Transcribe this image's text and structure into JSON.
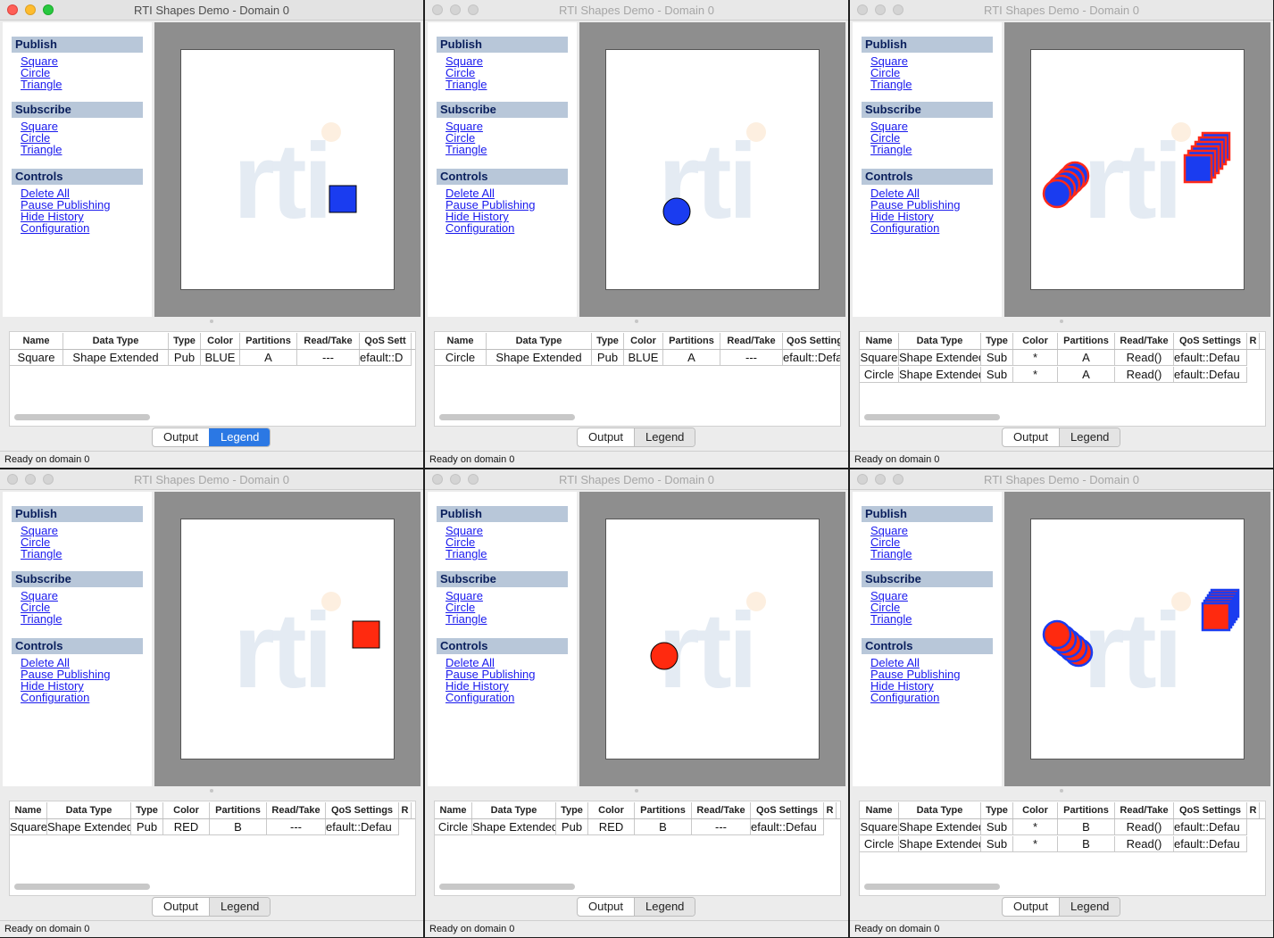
{
  "windows": [
    {
      "title": "RTI Shapes Demo - Domain 0",
      "active": true,
      "shapes": [
        {
          "kind": "square",
          "fill": "#1a3cf0",
          "stroke": "#000000",
          "color": "BLUE"
        }
      ],
      "columns": [
        "Name",
        "Data Type",
        "Type",
        "Color",
        "Partitions",
        "Read/Take",
        "QoS Sett"
      ],
      "rows": [
        [
          "Square",
          "Shape Extended",
          "Pub",
          "BLUE",
          "A",
          "---",
          "efault::D"
        ]
      ],
      "selected_tab": "Legend"
    },
    {
      "title": "RTI Shapes Demo - Domain 0",
      "active": false,
      "shapes": [
        {
          "kind": "circle",
          "fill": "#1a3cf0",
          "stroke": "#000000",
          "color": "BLUE"
        }
      ],
      "columns": [
        "Name",
        "Data Type",
        "Type",
        "Color",
        "Partitions",
        "Read/Take",
        "QoS Setting"
      ],
      "rows": [
        [
          "Circle",
          "Shape Extended",
          "Pub",
          "BLUE",
          "A",
          "---",
          "efault::Defa"
        ]
      ],
      "selected_tab": "Legend"
    },
    {
      "title": "RTI Shapes Demo - Domain 0",
      "active": false,
      "shapes": [
        {
          "kind": "circle-trail",
          "fill": "#1a3cf0",
          "stroke": "#ff2a1a"
        },
        {
          "kind": "square-trail",
          "fill": "#1a3cf0",
          "stroke": "#ff2a1a"
        }
      ],
      "columns": [
        "Name",
        "Data Type",
        "Type",
        "Color",
        "Partitions",
        "Read/Take",
        "QoS Settings",
        "R"
      ],
      "rows": [
        [
          "Square",
          "Shape Extended",
          "Sub",
          "*",
          "A",
          "Read()",
          "efault::Defau"
        ],
        [
          "Circle",
          "Shape Extended",
          "Sub",
          "*",
          "A",
          "Read()",
          "efault::Defau"
        ]
      ],
      "selected_tab": "Legend"
    },
    {
      "title": "RTI Shapes Demo - Domain 0",
      "active": false,
      "shapes": [
        {
          "kind": "square",
          "fill": "#ff2a0f",
          "stroke": "#000000",
          "color": "RED"
        }
      ],
      "columns": [
        "Name",
        "Data Type",
        "Type",
        "Color",
        "Partitions",
        "Read/Take",
        "QoS Settings",
        "R"
      ],
      "rows": [
        [
          "Square",
          "Shape Extended",
          "Pub",
          "RED",
          "B",
          "---",
          "efault::Defau"
        ]
      ],
      "selected_tab": "Legend"
    },
    {
      "title": "RTI Shapes Demo - Domain 0",
      "active": false,
      "shapes": [
        {
          "kind": "circle",
          "fill": "#ff2a0f",
          "stroke": "#000000",
          "color": "RED"
        }
      ],
      "columns": [
        "Name",
        "Data Type",
        "Type",
        "Color",
        "Partitions",
        "Read/Take",
        "QoS Settings",
        "R"
      ],
      "rows": [
        [
          "Circle",
          "Shape Extended",
          "Pub",
          "RED",
          "B",
          "---",
          "efault::Defau"
        ]
      ],
      "selected_tab": "Legend"
    },
    {
      "title": "RTI Shapes Demo - Domain 0",
      "active": false,
      "shapes": [
        {
          "kind": "circle-trail",
          "fill": "#ff2a0f",
          "stroke": "#1a3cf0"
        },
        {
          "kind": "square-trail",
          "fill": "#ff2a0f",
          "stroke": "#1a3cf0"
        }
      ],
      "columns": [
        "Name",
        "Data Type",
        "Type",
        "Color",
        "Partitions",
        "Read/Take",
        "QoS Settings",
        "R"
      ],
      "rows": [
        [
          "Square",
          "Shape Extended",
          "Sub",
          "*",
          "B",
          "Read()",
          "efault::Defau"
        ],
        [
          "Circle",
          "Shape Extended",
          "Sub",
          "*",
          "B",
          "Read()",
          "efault::Defau"
        ]
      ],
      "selected_tab": "Legend"
    }
  ],
  "sidebar": {
    "publish_header": "Publish",
    "subscribe_header": "Subscribe",
    "controls_header": "Controls",
    "publish_items": [
      "Square",
      "Circle",
      "Triangle"
    ],
    "subscribe_items": [
      "Square",
      "Circle",
      "Triangle"
    ],
    "controls_items": [
      "Delete All",
      "Pause Publishing",
      "Hide History",
      "Configuration"
    ]
  },
  "logo_text": "rti",
  "tabs": {
    "output": "Output",
    "legend": "Legend"
  },
  "status_text": "Ready on domain 0"
}
